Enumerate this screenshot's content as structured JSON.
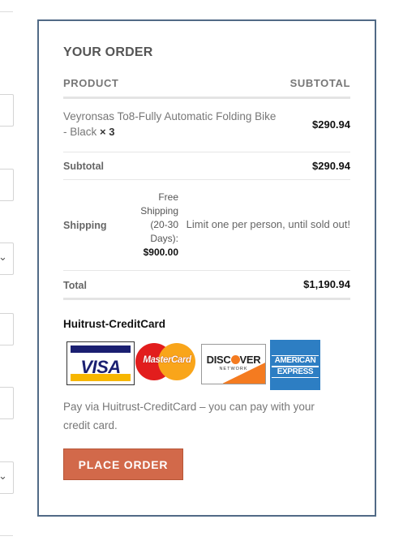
{
  "order": {
    "title": "YOUR ORDER",
    "columns": {
      "product": "PRODUCT",
      "subtotal": "SUBTOTAL"
    },
    "item": {
      "name": "Veyronsas To8-Fully Automatic Folding Bike - Black",
      "quantity": "× 3",
      "total": "$290.94"
    },
    "subtotal": {
      "label": "Subtotal",
      "value": "$290.94"
    },
    "shipping": {
      "label": "Shipping",
      "option_lines": [
        "Free",
        "Shipping",
        "(20-30",
        "Days):"
      ],
      "option_price": "$900.00",
      "note": "Limit one per person, until sold out!"
    },
    "total": {
      "label": "Total",
      "value": "$1,190.94"
    }
  },
  "payment": {
    "gateway_title": "Huitrust-CreditCard",
    "cards": [
      {
        "name": "visa-logo",
        "text": "VISA"
      },
      {
        "name": "mastercard-logo",
        "text": "MasterCard"
      },
      {
        "name": "discover-logo",
        "text_before": "DISC",
        "text_after": "VER",
        "subtext": "NETWORK"
      },
      {
        "name": "amex-logo",
        "text_line1": "AMERICAN",
        "text_line2": "EXPRESS"
      }
    ],
    "description": "Pay via Huitrust-CreditCard – you can pay with your credit card.",
    "button_label": "PLACE ORDER"
  },
  "colors": {
    "panel_border": "#516a86",
    "button": "#d2694a",
    "visa_blue": "#1a1f71",
    "amex_blue": "#2d7ec3",
    "discover_orange": "#f47b20"
  },
  "icons": {
    "select_chevron": "chevron-down-icon"
  }
}
